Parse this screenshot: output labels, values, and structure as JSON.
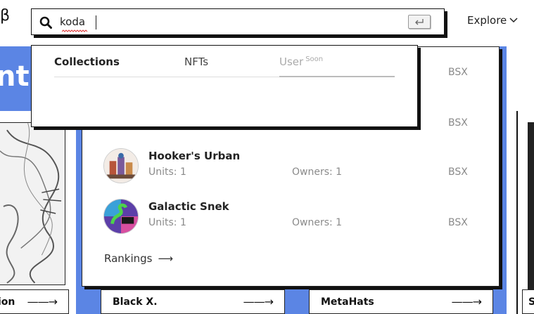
{
  "header": {
    "brand": "β",
    "explore_label": "Explore"
  },
  "hero": {
    "text": "nt"
  },
  "search": {
    "value": "koda",
    "placeholder": ""
  },
  "tabs": [
    {
      "label": "Collections"
    },
    {
      "label": "NFTs"
    },
    {
      "label": "User",
      "badge": "Soon"
    }
  ],
  "results": {
    "partial_rows": [
      {
        "currency": "BSX"
      },
      {
        "currency": "BSX"
      }
    ],
    "rows": [
      {
        "name": "Hooker's Urban",
        "units": "Units: 1",
        "owners": "Owners: 1",
        "currency": "BSX"
      },
      {
        "name": "Galactic Snek",
        "units": "Units: 1",
        "owners": "Owners: 1",
        "currency": "BSX"
      }
    ],
    "rankings_label": "Rankings",
    "rankings_arrow": "⟶"
  },
  "cards": [
    {
      "title": "ion",
      "arrow": "——→"
    },
    {
      "title": "Black X.",
      "arrow": "——→"
    },
    {
      "title": "MetaHats",
      "arrow": "——→"
    },
    {
      "title": "S",
      "arrow": ""
    }
  ],
  "colors": {
    "accent_blue": "#5b85e4",
    "border": "#111111",
    "muted_text": "#8a8a8a"
  }
}
